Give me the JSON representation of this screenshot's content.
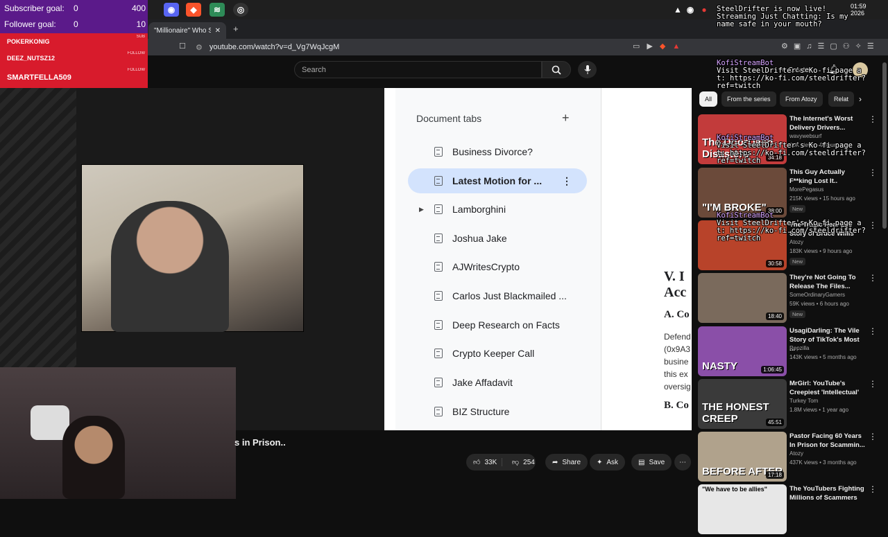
{
  "stream_overlay": {
    "subscriber_goal": {
      "label": "Subscriber goal:",
      "current": "0",
      "target": "400"
    },
    "follower_goal": {
      "label": "Follower goal:",
      "current": "0",
      "target": "10"
    },
    "alerts": [
      {
        "name": "POKERKONIG",
        "tag": "SUB"
      },
      {
        "name": "DEEZ_NUTSZ12",
        "tag": "FOLLOW"
      },
      {
        "name": "SMARTFELLA509",
        "tag": "FOLLOW"
      }
    ]
  },
  "browser": {
    "tab_title": "\"Millionaire\" Who Su",
    "url": "youtube.com/watch?v=d_Vg7WqJcgM"
  },
  "youtube": {
    "search_placeholder": "Search",
    "create_label": "Create",
    "video_title_fragment": "s in Prison..",
    "actions": {
      "likes": "33K",
      "dislikes": "254",
      "share": "Share",
      "ask": "Ask",
      "save": "Save"
    },
    "chips": [
      "All",
      "From the series",
      "From Atozy",
      "Relat"
    ]
  },
  "document": {
    "panel_title": "Document tabs",
    "tabs": [
      "Business Divorce?",
      "Latest Motion for ...",
      "Lamborghini",
      "Joshua Jake",
      "AJWritesCrypto",
      "Carlos Just Blackmailed ...",
      "Deep Research on Facts",
      "Crypto Keeper Call",
      "Jake Affadavit",
      "BIZ Structure"
    ],
    "right_fragments": {
      "heading": "V. I",
      "heading2": "Acc",
      "sub": "A. Co",
      "body1": "Defend",
      "body2": "(0x9A3",
      "body3": "busine",
      "body4": "this ex",
      "body5": "oversig",
      "sub2": "B. Co"
    }
  },
  "chat": {
    "header": "SteelDrifter is now live! Streaming Just Chatting: Is my name safe in your mouth?",
    "messages": [
      {
        "user": "KofiStreamBot",
        "text": "Visit SteelDrifter's Ko-fi page at: https://ko-fi.com/steeldrifter?ref=twitch"
      },
      {
        "user": "KofiStreamBot",
        "text": "Visit SteelDrifter's Ko-fi page at: https://ko-fi.com/steeldrifter?ref=twitch"
      },
      {
        "user": "KofiStreamBot",
        "text": "Visit SteelDrifter's Ko-fi page at: https://ko-fi.com/steeldrifter?ref=twitch"
      }
    ]
  },
  "clock": {
    "time": "01:59",
    "date": "2026"
  },
  "related_videos": [
    {
      "title": "The Internet's Worst Delivery Drivers...",
      "channel": "wavywebsurf",
      "meta": "90K views • 9 hours ago",
      "duration": "34:18",
      "thumb_text": "The DoorDash Disasters",
      "new": false,
      "color": "#c23b3b"
    },
    {
      "title": "This Guy Actually F**king Lost It..",
      "channel": "MorePegasus",
      "meta": "215K views • 15 hours ago",
      "duration": "38:00",
      "thumb_text": "\"I'M BROKE\"",
      "new": true,
      "color": "#6b4a3a"
    },
    {
      "title": "The Tragic Real-Life Story of Bruce Willis",
      "channel": "Atozy",
      "meta": "183K views • 9 hours ago",
      "duration": "30:58",
      "thumb_text": "",
      "new": true,
      "color": "#b8432a"
    },
    {
      "title": "They're Not Going To Release The Files...",
      "channel": "SomeOrdinaryGamers",
      "meta": "59K views • 6 hours ago",
      "duration": "18:40",
      "thumb_text": "",
      "new": true,
      "color": "#7a6a5c"
    },
    {
      "title": "UsagiDarling: The Vile Story of TikTok's Most ...",
      "channel": "Repzilla",
      "meta": "143K views • 5 months ago",
      "duration": "1:06:45",
      "thumb_text": "NASTY",
      "new": false,
      "color": "#8a4fa8"
    },
    {
      "title": "MrGirl: YouTube's Creepiest 'Intellectual'",
      "channel": "Turkey Tom",
      "meta": "1.8M views • 1 year ago",
      "duration": "45:51",
      "thumb_text": "THE HONEST CREEP",
      "new": false,
      "color": "#3a3a3a"
    },
    {
      "title": "Pastor Facing 60 Years In Prison for Scammin...",
      "channel": "Atozy",
      "meta": "437K views • 3 months ago",
      "duration": "17:18",
      "thumb_text": "BEFORE  AFTER",
      "new": false,
      "color": "#b0a28c"
    },
    {
      "title": "The YouTubers Fighting Millions of Scammers",
      "channel": "",
      "meta": "",
      "duration": "",
      "thumb_text": "\"We have to be allies\"",
      "new": false,
      "color": "#e7e7e7"
    }
  ]
}
